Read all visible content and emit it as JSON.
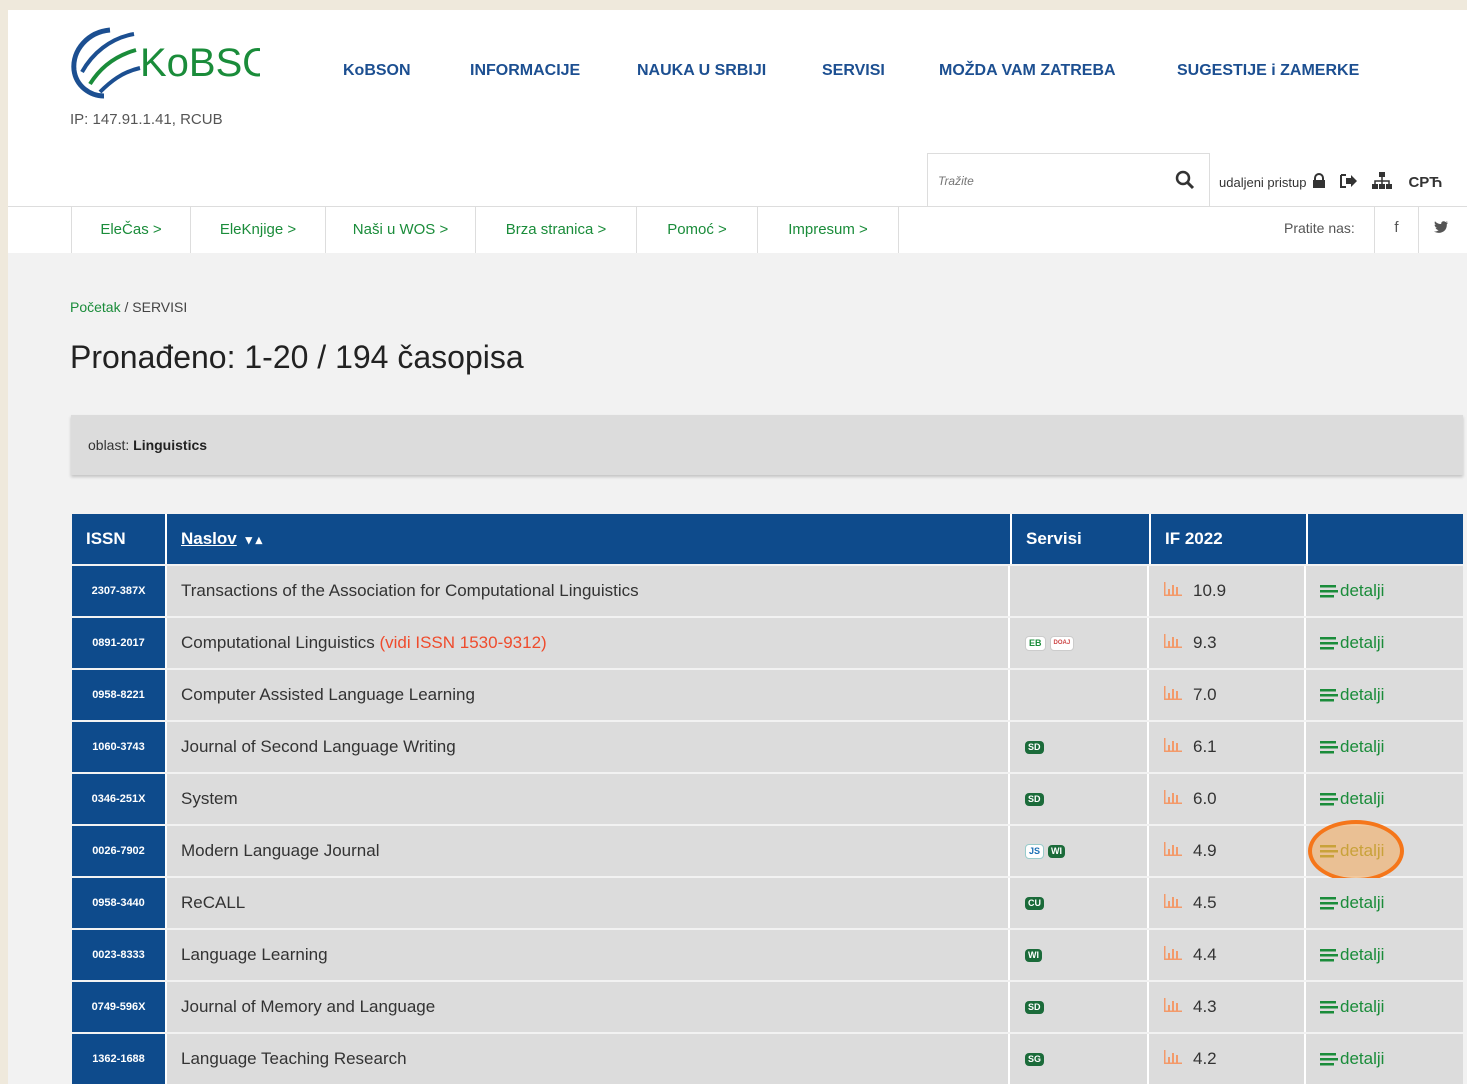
{
  "header": {
    "logo_text": "KoBSON",
    "ip": "IP: 147.91.1.41, RCUB",
    "nav": [
      "KoBSON",
      "INFORMACIJE",
      "NAUKA U SRBIJI",
      "SERVISI",
      "MOŽDA VAM ZATREBA",
      "SUGESTIJE i ZAMERKE"
    ],
    "search_placeholder": "Tražite",
    "remote_access": "udaljeni pristup",
    "lang": "СРЋ"
  },
  "subnav": {
    "items": [
      "EleČas >",
      "EleKnjige >",
      "Naši u WOS >",
      "Brza stranica >",
      "Pomoć >",
      "Impresum >"
    ],
    "follow": "Pratite nas:"
  },
  "breadcrumb": {
    "home": "Početak",
    "sep": "/",
    "current": "SERVISI"
  },
  "title": "Pronađeno: 1-20 / 194 časopisa",
  "filter": {
    "label": "oblast:",
    "value": "Linguistics"
  },
  "table": {
    "headers": {
      "issn": "ISSN",
      "naslov": "Naslov",
      "servisi": "Servisi",
      "if": "IF 2022",
      "actions": ""
    },
    "sort_icons": "▾ ▴",
    "details_label": "detalji",
    "rows": [
      {
        "issn": "2307-387X",
        "title": "Transactions of the Association for Computational Linguistics",
        "note": "",
        "services": [],
        "if": "10.9"
      },
      {
        "issn": "0891-2017",
        "title": "Computational Linguistics",
        "note": "(vidi ISSN 1530-9312)",
        "services": [
          "EB",
          "DOAJ"
        ],
        "if": "9.3"
      },
      {
        "issn": "0958-8221",
        "title": "Computer Assisted Language Learning",
        "note": "",
        "services": [],
        "if": "7.0"
      },
      {
        "issn": "1060-3743",
        "title": "Journal of Second Language Writing",
        "note": "",
        "services": [
          "SD"
        ],
        "if": "6.1"
      },
      {
        "issn": "0346-251X",
        "title": "System",
        "note": "",
        "services": [
          "SD"
        ],
        "if": "6.0"
      },
      {
        "issn": "0026-7902",
        "title": "Modern Language Journal",
        "note": "",
        "services": [
          "JS",
          "WI"
        ],
        "if": "4.9",
        "highlighted": true
      },
      {
        "issn": "0958-3440",
        "title": "ReCALL",
        "note": "",
        "services": [
          "CU"
        ],
        "if": "4.5"
      },
      {
        "issn": "0023-8333",
        "title": "Language Learning",
        "note": "",
        "services": [
          "WI"
        ],
        "if": "4.4"
      },
      {
        "issn": "0749-596X",
        "title": "Journal of Memory and Language",
        "note": "",
        "services": [
          "SD"
        ],
        "if": "4.3"
      },
      {
        "issn": "1362-1688",
        "title": "Language Teaching Research",
        "note": "",
        "services": [
          "SG"
        ],
        "if": "4.2"
      }
    ]
  },
  "colors": {
    "brand_blue": "#0e4b8c",
    "link_green": "#1a8c3a",
    "highlight_orange": "#f5761a"
  }
}
